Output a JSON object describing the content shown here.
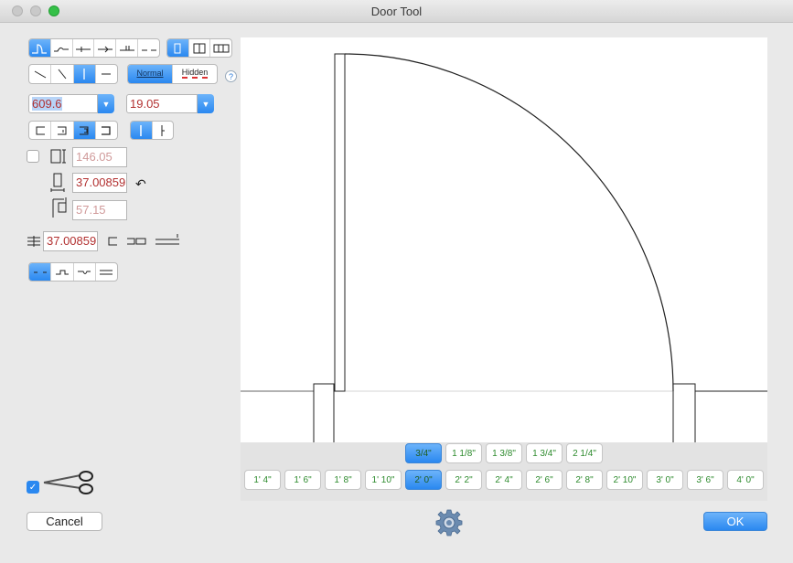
{
  "window": {
    "title": "Door Tool"
  },
  "line_style": {
    "normal_label": "Normal",
    "hidden_label": "Hidden",
    "help_label": "?"
  },
  "dimensions": {
    "width_value": "609.6",
    "thickness_value": "19.05"
  },
  "fields": {
    "frame_value": "146.05",
    "reveal_value": "37.00859",
    "offset_value": "57.15",
    "wall_value": "37.00859"
  },
  "thickness_presets": [
    "3/4\"",
    "1 1/8\"",
    "1 3/8\"",
    "1 3/4\"",
    "2 1/4\""
  ],
  "width_presets": [
    "1' 4\"",
    "1' 6\"",
    "1' 8\"",
    "1' 10\"",
    "2' 0\"",
    "2' 2\"",
    "2' 4\"",
    "2' 6\"",
    "2' 8\"",
    "2' 10\"",
    "3' 0\"",
    "3' 6\"",
    "4' 0\""
  ],
  "selected_thickness": "3/4\"",
  "selected_width": "2' 0\"",
  "footer": {
    "cancel_label": "Cancel",
    "ok_label": "OK"
  },
  "colors": {
    "accent": "#2a88f0",
    "preset_text": "#2c8a2c",
    "value_text": "#b23030"
  }
}
